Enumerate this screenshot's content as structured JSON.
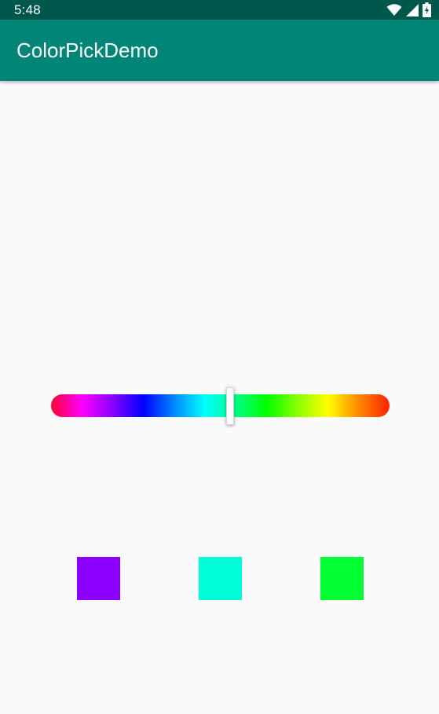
{
  "status_bar": {
    "time": "5:48",
    "background": "#00574b",
    "icons": [
      "wifi-icon",
      "signal-icon",
      "battery-icon"
    ]
  },
  "app_bar": {
    "title": "ColorPickDemo",
    "background": "#008577"
  },
  "hue_slider": {
    "position": 0.53,
    "gradient_colors": [
      "#ff0033",
      "#ff00ff",
      "#8a00ff",
      "#0000ff",
      "#0088ff",
      "#00ffff",
      "#00ff88",
      "#00ff00",
      "#88ff00",
      "#ffff00",
      "#ff8800",
      "#ff2200"
    ]
  },
  "swatches": [
    {
      "color": "#8b00ff"
    },
    {
      "color": "#00ffd8"
    },
    {
      "color": "#00ff33"
    }
  ]
}
